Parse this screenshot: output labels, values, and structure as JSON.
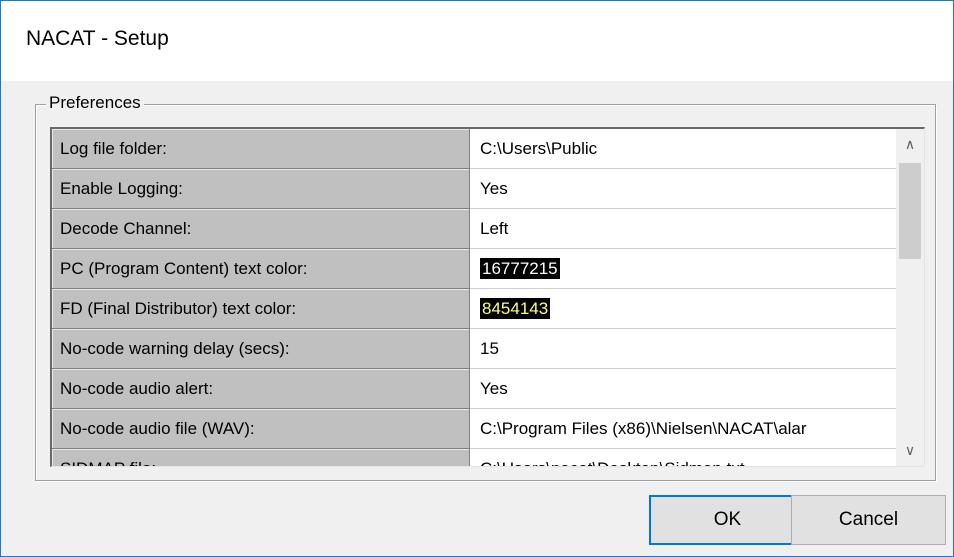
{
  "window": {
    "title": "NACAT - Setup"
  },
  "preferences": {
    "group_label": "Preferences",
    "rows": [
      {
        "label": "Log file folder:",
        "value": "C:\\Users\\Public"
      },
      {
        "label": "Enable Logging:",
        "value": "Yes"
      },
      {
        "label": "Decode Channel:",
        "value": "Left"
      },
      {
        "label": "PC (Program Content) text color:",
        "value": "16777215",
        "value_fg": "#ffffff",
        "value_bg": "#000000"
      },
      {
        "label": "FD (Final Distributor) text color:",
        "value": "8454143",
        "value_fg": "#ffff80",
        "value_bg": "#000000"
      },
      {
        "label": "No-code warning delay (secs):",
        "value": "15"
      },
      {
        "label": "No-code audio alert:",
        "value": "Yes"
      },
      {
        "label": "No-code audio file (WAV):",
        "value": "C:\\Program Files (x86)\\Nielsen\\NACAT\\alar"
      },
      {
        "label": "SIDMAP file:",
        "value": "C:\\Users\\nacat\\Desktop\\Sidmap.txt"
      }
    ],
    "scrollbar": {
      "up_icon": "chevron-up-icon",
      "down_icon": "chevron-down-icon"
    }
  },
  "buttons": {
    "ok": "OK",
    "cancel": "Cancel"
  },
  "colors": {
    "accent": "#0078d7",
    "window_border": "#1979ca",
    "label_bg": "#c0c0c0"
  }
}
